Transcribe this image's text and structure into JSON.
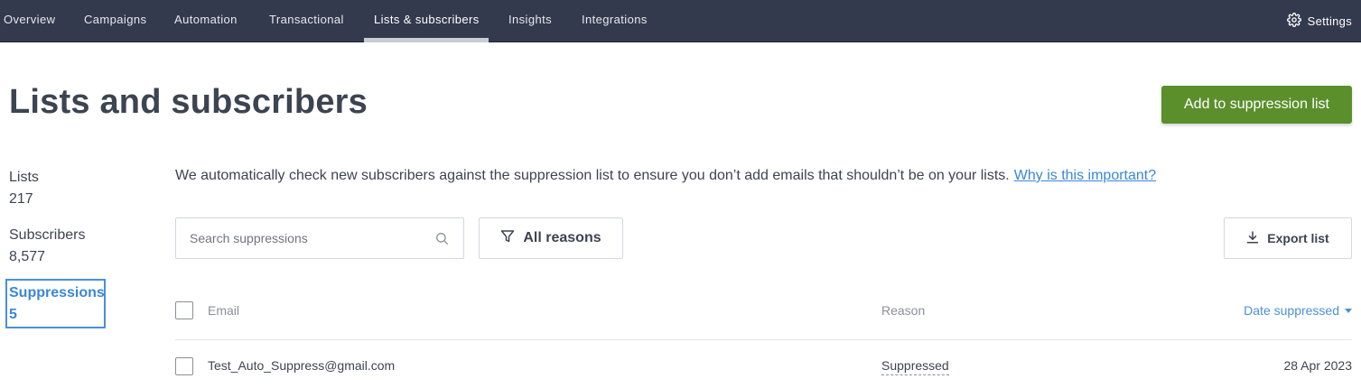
{
  "nav": {
    "tabs": [
      {
        "label": "Overview"
      },
      {
        "label": "Campaigns"
      },
      {
        "label": "Automation"
      },
      {
        "label": "Transactional"
      },
      {
        "label": "Lists & subscribers"
      },
      {
        "label": "Insights"
      },
      {
        "label": "Integrations"
      }
    ],
    "active_tab": "Lists & subscribers",
    "settings_label": "Settings"
  },
  "header": {
    "title": "Lists and subscribers",
    "primary_button": "Add to suppression list"
  },
  "sidebar": {
    "items": [
      {
        "label": "Lists",
        "count": "217"
      },
      {
        "label": "Subscribers",
        "count": "8,577"
      },
      {
        "label": "Suppressions",
        "count": "5"
      }
    ],
    "active_item": "Suppressions"
  },
  "main": {
    "info_text": "We automatically check new subscribers against the suppression list to ensure you don’t add emails that shouldn’t be on your lists.",
    "info_link": "Why is this important?",
    "search": {
      "placeholder": "Search suppressions",
      "value": ""
    },
    "filter_label": "All reasons",
    "export_label": "Export list"
  },
  "table": {
    "columns": {
      "email": "Email",
      "reason": "Reason",
      "date": "Date suppressed"
    },
    "rows": [
      {
        "email": "Test_Auto_Suppress@gmail.com",
        "reason": "Suppressed",
        "date": "28 Apr 2023"
      }
    ]
  },
  "colors": {
    "nav_bg": "#333a4d",
    "primary_green": "#5a8f2c",
    "link_blue": "#3b86d8",
    "text": "#3d4451"
  },
  "icons": {
    "settings": "gear-icon",
    "search": "search-icon",
    "filter": "filter-icon",
    "export": "download-icon",
    "sort": "caret-down-icon"
  }
}
